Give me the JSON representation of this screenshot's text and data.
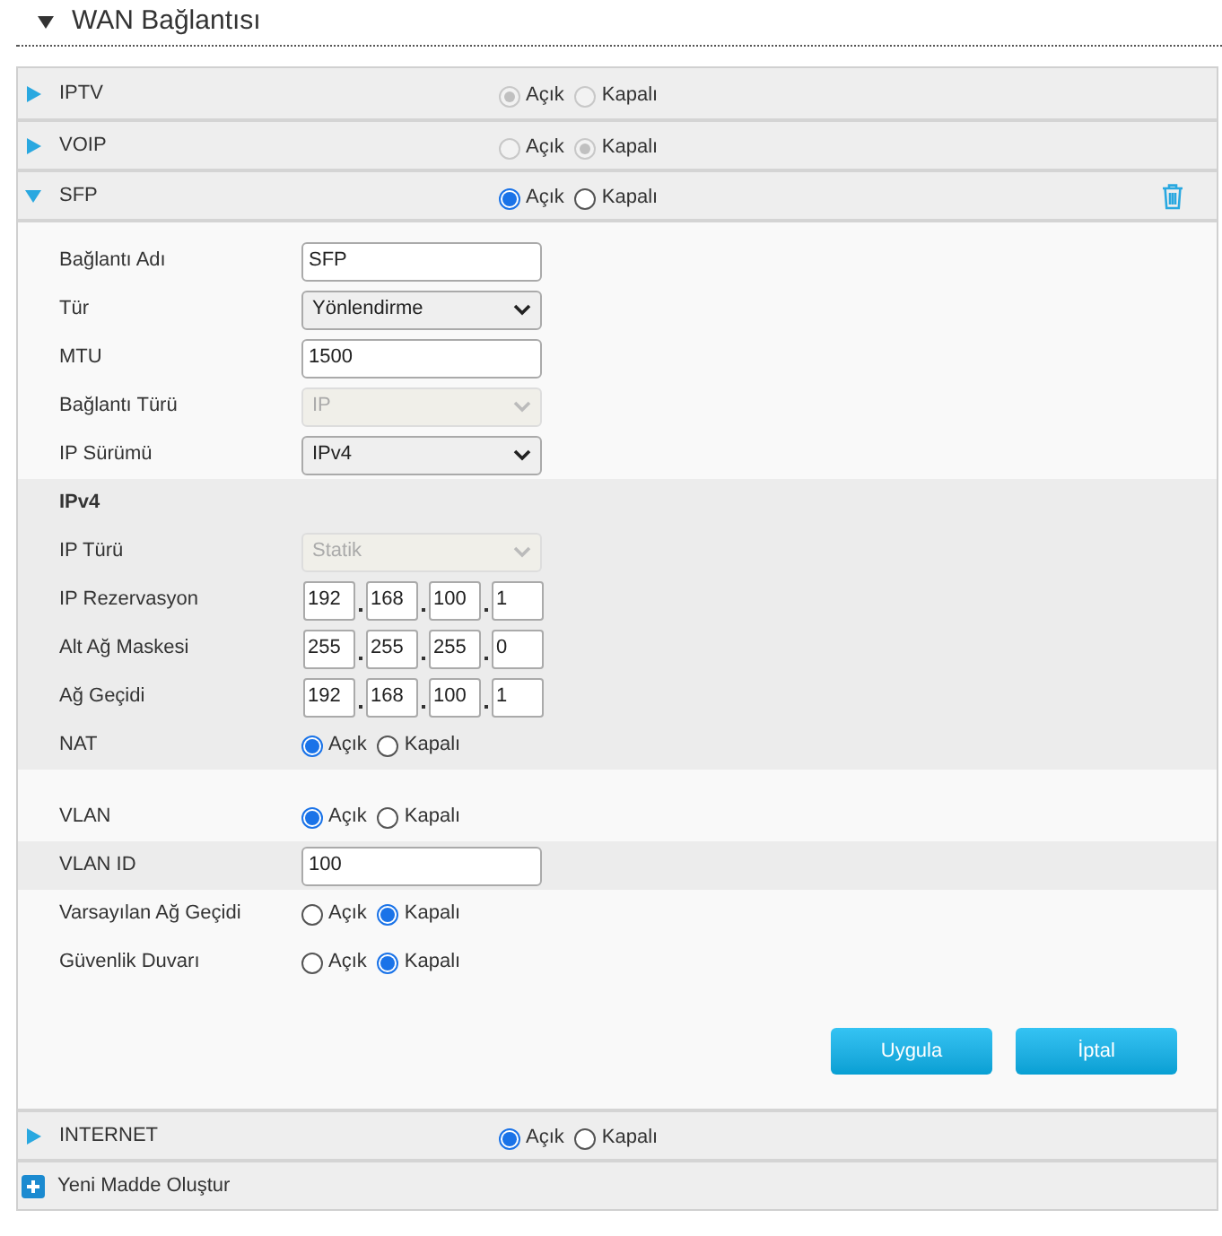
{
  "title": "WAN Bağlantısı",
  "expanded": true,
  "connections": [
    {
      "name": "IPTV",
      "expanded": false,
      "disabled": true,
      "deletable": false,
      "options": [
        {
          "label": "Açık",
          "selected": true
        },
        {
          "label": "Kapalı",
          "selected": false
        }
      ]
    },
    {
      "name": "VOIP",
      "expanded": false,
      "disabled": true,
      "deletable": false,
      "options": [
        {
          "label": "Açık",
          "selected": false
        },
        {
          "label": "Kapalı",
          "selected": true
        }
      ]
    },
    {
      "name": "SFP",
      "expanded": true,
      "disabled": false,
      "deletable": true,
      "options": [
        {
          "label": "Açık",
          "selected": true
        },
        {
          "label": "Kapalı",
          "selected": false
        }
      ],
      "form": {
        "sections": [
          {
            "shaded": false,
            "rows": [
              {
                "kind": "text",
                "label": "Bağlantı Adı",
                "value": "SFP"
              },
              {
                "kind": "select",
                "label": "Tür",
                "value": "Yönlendirme",
                "disabled": false
              },
              {
                "kind": "text",
                "label": "MTU",
                "value": "1500"
              },
              {
                "kind": "select",
                "label": "Bağlantı Türü",
                "value": "IP",
                "disabled": true
              },
              {
                "kind": "select",
                "label": "IP Sürümü",
                "value": "IPv4",
                "disabled": false
              }
            ]
          },
          {
            "shaded": true,
            "rows": [
              {
                "kind": "heading",
                "label": "IPv4"
              },
              {
                "kind": "select",
                "label": "IP Türü",
                "value": "Statik",
                "disabled": true
              },
              {
                "kind": "ip",
                "label": "IP Rezervasyon",
                "octets": [
                  "192",
                  "168",
                  "100",
                  "1"
                ]
              },
              {
                "kind": "ip",
                "label": "Alt Ağ Maskesi",
                "octets": [
                  "255",
                  "255",
                  "255",
                  "0"
                ]
              },
              {
                "kind": "ip",
                "label": "Ağ Geçidi",
                "octets": [
                  "192",
                  "168",
                  "100",
                  "1"
                ]
              },
              {
                "kind": "radio",
                "label": "NAT",
                "options": [
                  {
                    "label": "Açık",
                    "selected": true
                  },
                  {
                    "label": "Kapalı",
                    "selected": false
                  }
                ]
              }
            ]
          },
          {
            "shaded": false,
            "rows": [
              {
                "kind": "radio",
                "label": "VLAN",
                "options": [
                  {
                    "label": "Açık",
                    "selected": true
                  },
                  {
                    "label": "Kapalı",
                    "selected": false
                  }
                ]
              }
            ]
          },
          {
            "shaded": true,
            "rows": [
              {
                "kind": "text",
                "label": "VLAN ID",
                "value": "100"
              }
            ]
          },
          {
            "shaded": false,
            "rows": [
              {
                "kind": "radio",
                "label": "Varsayılan Ağ Geçidi",
                "options": [
                  {
                    "label": "Açık",
                    "selected": false
                  },
                  {
                    "label": "Kapalı",
                    "selected": true
                  }
                ]
              },
              {
                "kind": "radio",
                "label": "Güvenlik Duvarı",
                "options": [
                  {
                    "label": "Açık",
                    "selected": false
                  },
                  {
                    "label": "Kapalı",
                    "selected": true
                  }
                ]
              }
            ]
          }
        ],
        "buttons": [
          "Uygula",
          "İptal"
        ]
      }
    },
    {
      "name": "INTERNET",
      "expanded": false,
      "disabled": false,
      "deletable": false,
      "options": [
        {
          "label": "Açık",
          "selected": true
        },
        {
          "label": "Kapalı",
          "selected": false
        }
      ]
    }
  ],
  "add_item": "Yeni Madde Oluştur"
}
